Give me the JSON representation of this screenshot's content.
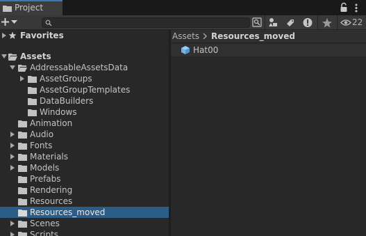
{
  "window": {
    "tab_title": "Project"
  },
  "toolbar": {
    "add_label": "+",
    "search_value": "",
    "hidden_count": "22"
  },
  "breadcrumb": {
    "root": "Assets",
    "current": "Resources_moved"
  },
  "tree": {
    "favorites": "Favorites",
    "assets": "Assets",
    "items": [
      {
        "label": "AddressableAssetsData",
        "expanded": true
      },
      {
        "label": "AssetGroups"
      },
      {
        "label": "AssetGroupTemplates"
      },
      {
        "label": "DataBuilders"
      },
      {
        "label": "Windows"
      },
      {
        "label": "Animation"
      },
      {
        "label": "Audio"
      },
      {
        "label": "Fonts"
      },
      {
        "label": "Materials"
      },
      {
        "label": "Models"
      },
      {
        "label": "Prefabs"
      },
      {
        "label": "Rendering"
      },
      {
        "label": "Resources"
      },
      {
        "label": "Resources_moved",
        "selected": true
      },
      {
        "label": "Scenes"
      },
      {
        "label": "Scripts"
      }
    ]
  },
  "content": {
    "items": [
      {
        "label": "Hat00",
        "icon": "prefab-cube-icon"
      }
    ]
  },
  "colors": {
    "selection": "#2c5d87",
    "accent": "#3a79bb",
    "prefab": "#6fb5e8"
  }
}
